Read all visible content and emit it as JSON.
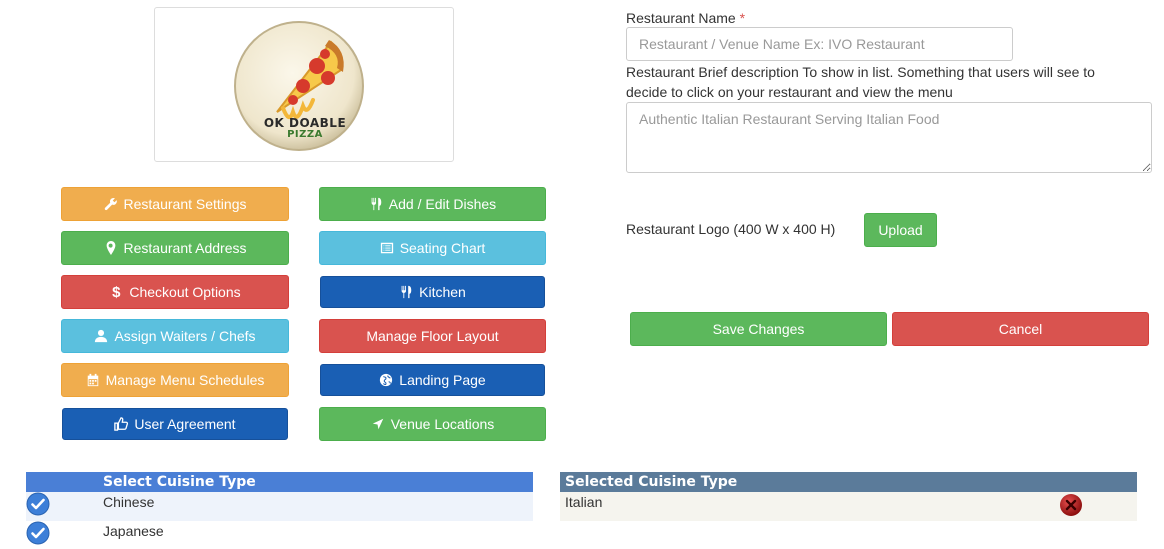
{
  "logo": {
    "line1": "OK DOABLE",
    "line2": "PIZZA"
  },
  "buttons": {
    "restaurant_settings": "Restaurant Settings",
    "add_edit_dishes": "Add / Edit Dishes",
    "restaurant_address": "Restaurant Address",
    "seating_chart": "Seating Chart",
    "checkout_options": "Checkout Options",
    "kitchen": "Kitchen",
    "assign_waiters": "Assign Waiters / Chefs",
    "manage_floor_layout": "Manage Floor Layout",
    "manage_menu_schedules": "Manage Menu Schedules",
    "landing_page": "Landing Page",
    "user_agreement": "User Agreement",
    "venue_locations": "Venue Locations"
  },
  "form": {
    "name_label": "Restaurant Name",
    "required_mark": "*",
    "name_placeholder": "Restaurant / Venue Name Ex: IVO Restaurant",
    "description_label_line1": "Restaurant Brief description To show in list. Something that users will see to",
    "description_label_line2": "decide to click on your restaurant and view the menu",
    "description_placeholder": "Authentic Italian Restaurant Serving Italian Food",
    "logo_label": "Restaurant Logo (400 W x 400 H)",
    "upload_label": "Upload",
    "save_label": "Save Changes",
    "cancel_label": "Cancel"
  },
  "cuisine": {
    "select_header": "Select Cuisine Type",
    "selected_header": "Selected Cuisine Type",
    "available": [
      "Chinese",
      "Japanese"
    ],
    "selected": [
      "Italian"
    ]
  },
  "colors": {
    "orange": "#f0ad4e",
    "green": "#5cb85c",
    "red": "#d9534f",
    "cyan": "#5bc0de",
    "blue": "#1a5fb4",
    "select_header_bg": "#4a7fd6",
    "selected_header_bg": "#5b7b9a"
  }
}
